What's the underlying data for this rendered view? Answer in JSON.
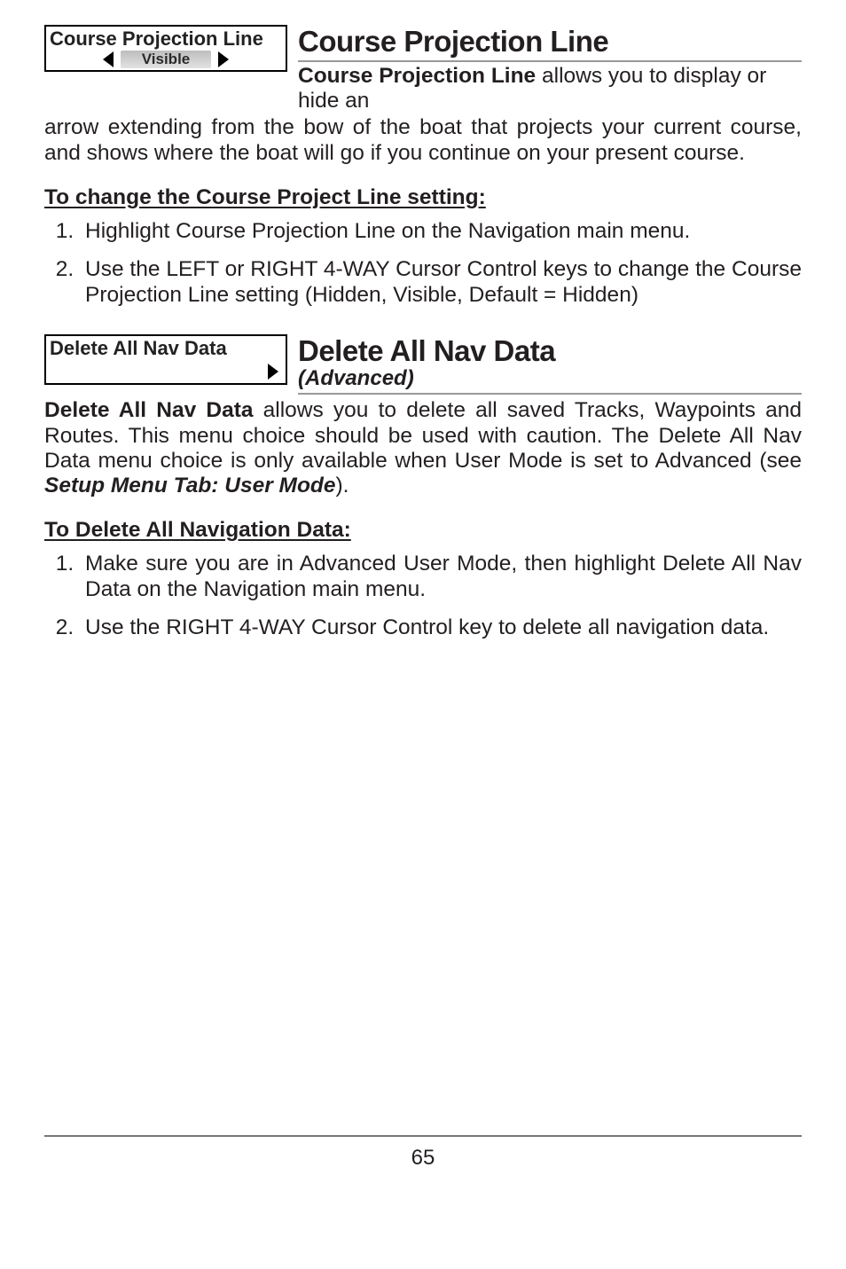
{
  "section1": {
    "ui_title": "Course Projection Line",
    "ui_value": "Visible",
    "heading": "Course Projection Line",
    "lead_bold": "Course Projection Line",
    "lead_rest_inline": " allows you to display or hide an",
    "lead_cont": "arrow extending from the bow of the boat that projects your current course, and shows where the boat will go if you continue on your present course.",
    "subheading": "To change the Course Project Line setting:",
    "steps": [
      "Highlight Course Projection Line on the Navigation main menu.",
      "Use the LEFT or RIGHT 4-WAY Cursor Control keys to change the Course Projection Line setting (Hidden, Visible, Default = Hidden)"
    ]
  },
  "section2": {
    "ui_title": "Delete All Nav Data",
    "heading": "Delete All Nav Data",
    "heading_sub": "(Advanced)",
    "lead_bold": "Delete All Nav Data",
    "lead_rest": " allows you to delete all saved Tracks, Waypoints and Routes.  This menu choice should be used with caution. The Delete All Nav Data menu choice is only available when User Mode is set to Advanced (see ",
    "lead_ref": "Setup Menu Tab: User Mode",
    "lead_close": ").",
    "subheading": "To Delete All Navigation Data:",
    "steps": [
      "Make sure you are in Advanced User Mode, then highlight Delete All Nav Data on the Navigation main menu.",
      "Use the RIGHT 4-WAY Cursor Control key to delete all navigation data."
    ]
  },
  "page_number": "65"
}
